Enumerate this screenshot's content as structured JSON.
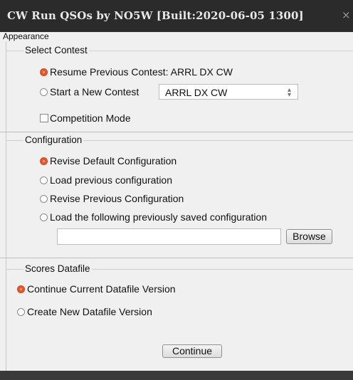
{
  "window": {
    "title": "CW Run QSOs by NO5W [Built:2020-06-05 1300]",
    "close_glyph": "×"
  },
  "menu": {
    "items": [
      "Appearance"
    ]
  },
  "select_contest": {
    "legend": "Select Contest",
    "resume_label": "Resume Previous Contest: ARRL DX CW",
    "start_label": "Start a New Contest",
    "contest_select_value": "ARRL DX CW",
    "competition_label": "Competition Mode",
    "selected": "resume",
    "competition_checked": false
  },
  "configuration": {
    "legend": "Configuration",
    "options": [
      "Revise Default Configuration",
      "Load previous configuration",
      "Revise Previous Configuration",
      "Load the following previously saved configuration"
    ],
    "selected_index": 0,
    "path_value": "",
    "browse_label": "Browse"
  },
  "scores": {
    "legend": "Scores Datafile",
    "options": [
      "Continue Current Datafile Version",
      "Create New Datafile Version"
    ],
    "selected_index": 0
  },
  "continue_label": "Continue",
  "colors": {
    "titlebar": "#2b2b2b",
    "radio_selected": "#e8572a",
    "background": "#f0f0f0"
  },
  "icons": {
    "close": "close-icon",
    "select_arrow": "up-down-arrows-icon"
  }
}
